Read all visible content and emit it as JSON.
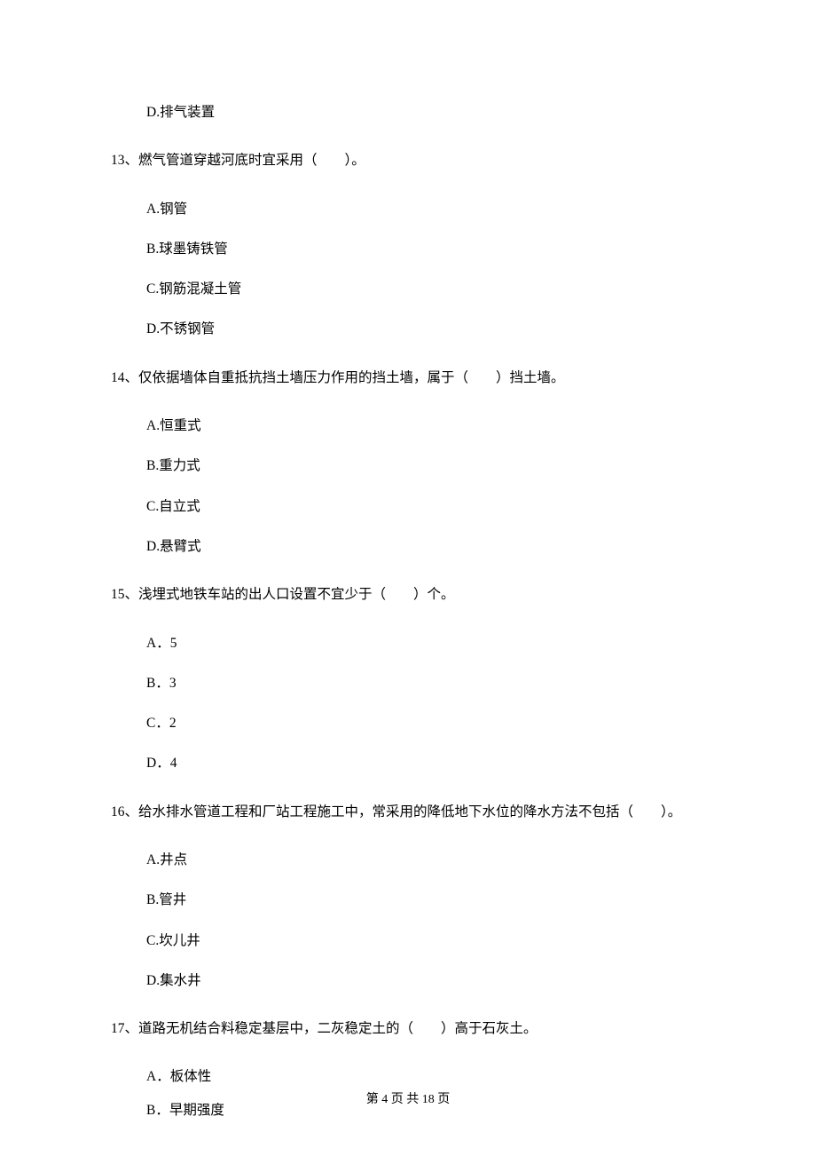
{
  "orphan_option": "D.排气装置",
  "questions": [
    {
      "num": "13",
      "text": "燃气管道穿越河底时宜采用（　　）。",
      "options": [
        "A.钢管",
        "B.球墨铸铁管",
        "C.钢筋混凝土管",
        "D.不锈钢管"
      ]
    },
    {
      "num": "14",
      "text": "仅依据墙体自重抵抗挡土墙压力作用的挡土墙，属于（　　）挡土墙。",
      "options": [
        "A.恒重式",
        "B.重力式",
        "C.自立式",
        "D.悬臂式"
      ]
    },
    {
      "num": "15",
      "text": "浅埋式地铁车站的出人口设置不宜少于（　　）个。",
      "options": [
        "A．5",
        "B．3",
        "C．2",
        "D．4"
      ]
    },
    {
      "num": "16",
      "text": "给水排水管道工程和厂站工程施工中，常采用的降低地下水位的降水方法不包括（　　）。",
      "options": [
        "A.井点",
        "B.管井",
        "C.坎儿井",
        "D.集水井"
      ]
    },
    {
      "num": "17",
      "text": "道路无机结合料稳定基层中，二灰稳定土的（　　）高于石灰土。",
      "options": [
        "A．板体性",
        "B．早期强度"
      ]
    }
  ],
  "footer": "第 4 页 共 18 页"
}
